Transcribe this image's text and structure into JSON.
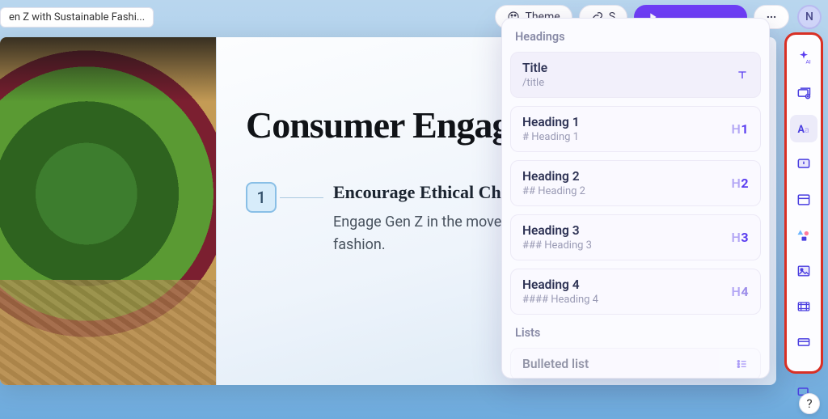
{
  "doc": {
    "title": "en Z with Sustainable Fashi..."
  },
  "toolbar": {
    "theme_label": "Theme",
    "share_label": "S",
    "present_label": " "
  },
  "avatar": {
    "initial": "N"
  },
  "slide": {
    "heading": "Consumer Engagement",
    "point_number": "1",
    "point_title": "Encourage Ethical Choices",
    "point_body": "Engage Gen Z in the movement towards sustainable fashion."
  },
  "panel": {
    "section_headings": "Headings",
    "section_lists": "Lists",
    "title": {
      "name": "Title",
      "hint": "/title"
    },
    "h1": {
      "name": "Heading 1",
      "hint": "# Heading 1"
    },
    "h2": {
      "name": "Heading 2",
      "hint": "## Heading 2"
    },
    "h3": {
      "name": "Heading 3",
      "hint": "### Heading 3"
    },
    "h4": {
      "name": "Heading 4",
      "hint": "#### Heading 4"
    },
    "bulleted": {
      "name": "Bulleted list"
    }
  },
  "help": {
    "label": "?"
  }
}
